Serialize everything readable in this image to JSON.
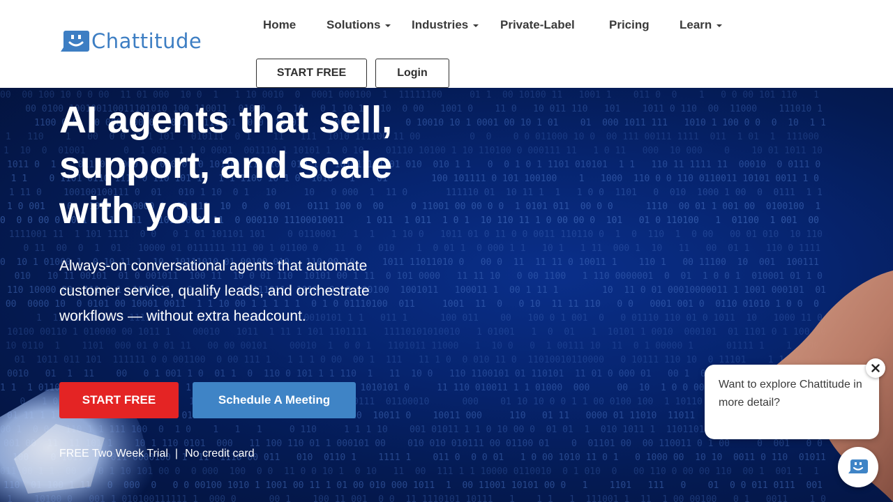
{
  "brand": {
    "name": "Chattitude",
    "color": "#3d7ec3"
  },
  "nav": {
    "items": [
      {
        "label": "Home",
        "dropdown": false
      },
      {
        "label": "Solutions",
        "dropdown": true
      },
      {
        "label": "Industries",
        "dropdown": true
      },
      {
        "label": "Private-Label",
        "dropdown": false
      },
      {
        "label": "Pricing",
        "dropdown": false
      },
      {
        "label": "Learn",
        "dropdown": true
      }
    ],
    "start_free": "START FREE",
    "login": "Login"
  },
  "hero": {
    "title": "AI agents that sell, support, and scale with you.",
    "subtitle": "Always-on conversational agents that automate customer service, qualify leads, and orchestrate workflows — without extra headcount.",
    "cta_primary": "START FREE",
    "cta_secondary": "Schedule A Meeting",
    "trial_note": "FREE Two Week Trial",
    "trial_separator": "|",
    "no_card_note": "No credit card"
  },
  "chat": {
    "message": "Want to explore Chattitude in more detail?"
  },
  "colors": {
    "primary_cta": "#e42424",
    "secondary_cta": "#3f84c6",
    "hero_bg": "#06246f"
  }
}
